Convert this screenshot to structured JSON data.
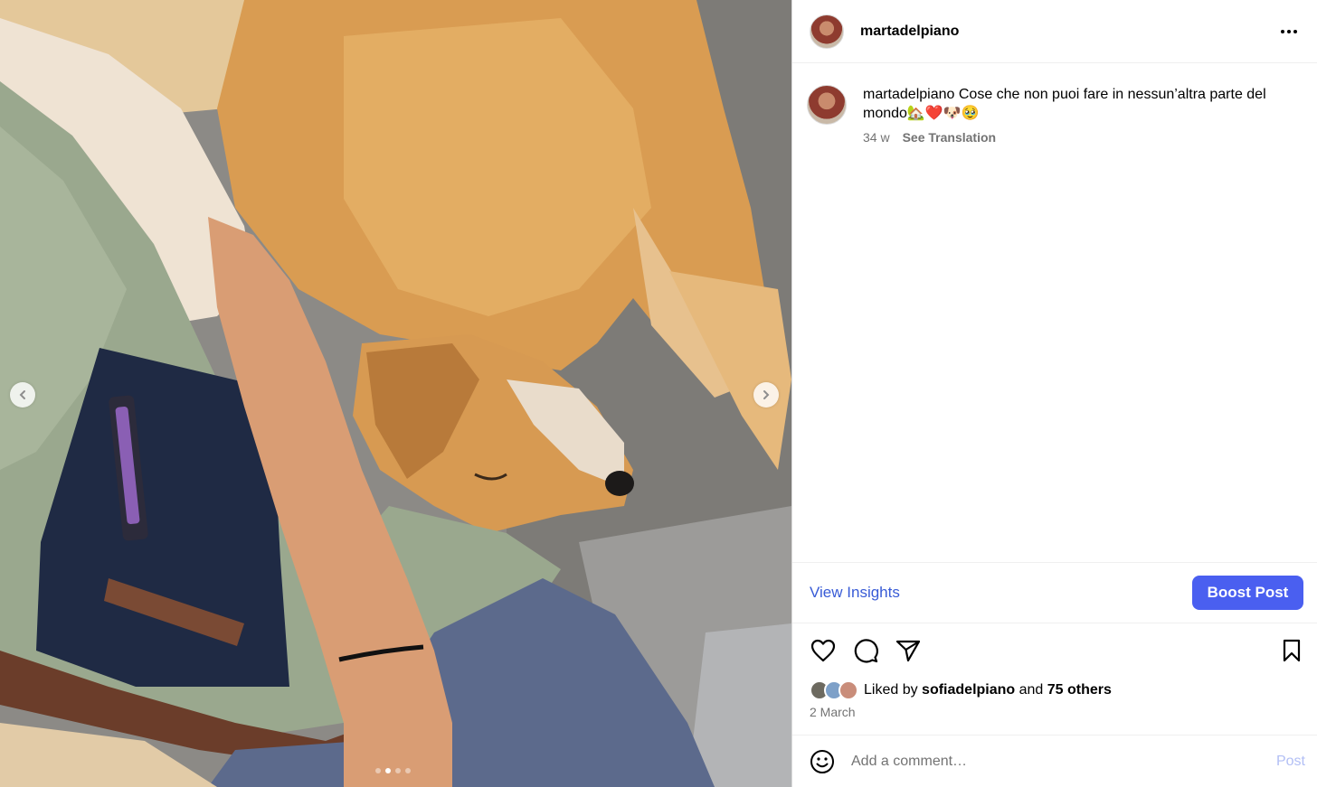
{
  "post": {
    "username": "martadelpiano",
    "caption_user": "martadelpiano",
    "caption_text": "Cose che non puoi fare in nessun’altra parte del mondo🏡❤️🐶🥹",
    "age": "34 w",
    "see_translation": "See Translation"
  },
  "carousel": {
    "slide_count": 4,
    "current_slide": 2
  },
  "insights": {
    "view_label": "View Insights",
    "boost_label": "Boost Post"
  },
  "likes": {
    "prefix": "Liked by ",
    "user": "sofiadelpiano",
    "middle": " and ",
    "others": "75 others"
  },
  "date": "2 March",
  "comment": {
    "placeholder": "Add a comment…",
    "post_label": "Post"
  },
  "colors": {
    "boost": "#4a5ff0",
    "link": "#385bd6",
    "muted": "#737373"
  },
  "icons": [
    "more-icon",
    "heart-icon",
    "comment-icon",
    "share-icon",
    "bookmark-icon",
    "emoji-icon",
    "chevron-left-icon",
    "chevron-right-icon"
  ]
}
